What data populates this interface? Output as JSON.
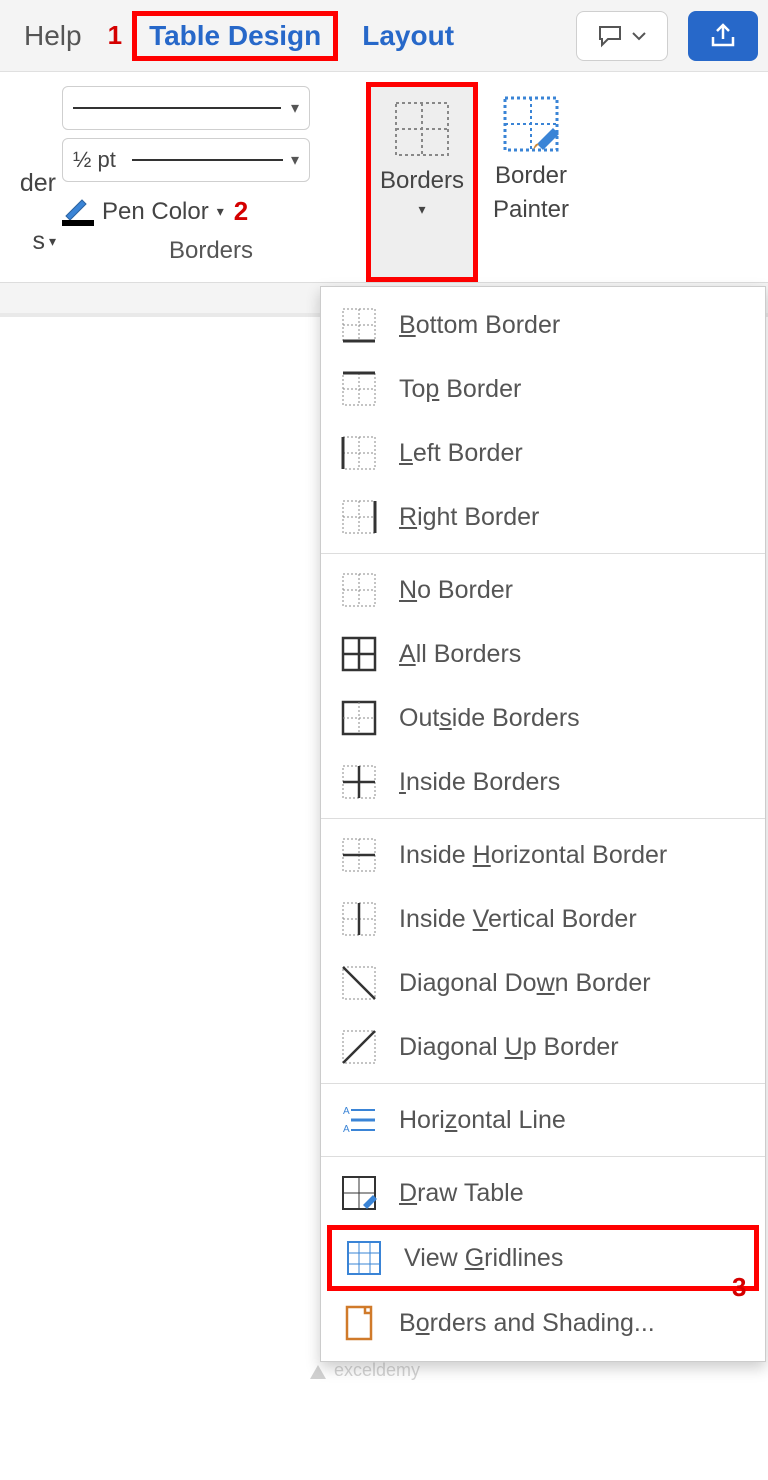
{
  "tabs": {
    "help": "Help",
    "table_design": "Table Design",
    "layout": "Layout"
  },
  "annotations": {
    "one": "1",
    "two": "2",
    "three": "3"
  },
  "ribbon": {
    "cut_left_line1": "der",
    "cut_left_line2": "s",
    "line_weight": "½ pt",
    "pen_color": "Pen Color",
    "group_label": "Borders",
    "borders_btn": "Borders",
    "border_painter_l1": "Border",
    "border_painter_l2": "Painter"
  },
  "menu": {
    "items": [
      {
        "id": "bottom",
        "label_pre": "",
        "u": "B",
        "label_post": "ottom Border"
      },
      {
        "id": "top",
        "label_pre": "To",
        "u": "p",
        "label_post": " Border"
      },
      {
        "id": "left",
        "label_pre": "",
        "u": "L",
        "label_post": "eft Border"
      },
      {
        "id": "right",
        "label_pre": "",
        "u": "R",
        "label_post": "ight Border"
      }
    ],
    "items2": [
      {
        "id": "none",
        "label_pre": "",
        "u": "N",
        "label_post": "o Border"
      },
      {
        "id": "all",
        "label_pre": "",
        "u": "A",
        "label_post": "ll Borders"
      },
      {
        "id": "outside",
        "label_pre": "Out",
        "u": "s",
        "label_post": "ide Borders"
      },
      {
        "id": "inside",
        "label_pre": "",
        "u": "I",
        "label_post": "nside Borders"
      }
    ],
    "items3": [
      {
        "id": "insideh",
        "label_pre": "Inside ",
        "u": "H",
        "label_post": "orizontal Border"
      },
      {
        "id": "insidev",
        "label_pre": "Inside ",
        "u": "V",
        "label_post": "ertical Border"
      },
      {
        "id": "diagd",
        "label_pre": "Diagonal Do",
        "u": "w",
        "label_post": "n Border"
      },
      {
        "id": "diagu",
        "label_pre": "Diagonal ",
        "u": "U",
        "label_post": "p Border"
      }
    ],
    "items4": [
      {
        "id": "hline",
        "label_pre": "Hori",
        "u": "z",
        "label_post": "ontal Line"
      }
    ],
    "items5": [
      {
        "id": "draw",
        "label_pre": "",
        "u": "D",
        "label_post": "raw Table"
      },
      {
        "id": "grid",
        "label_pre": "View ",
        "u": "G",
        "label_post": "ridlines"
      },
      {
        "id": "bshade",
        "label_pre": "B",
        "u": "o",
        "label_post": "rders and Shading..."
      }
    ]
  },
  "watermark": "exceldemy"
}
